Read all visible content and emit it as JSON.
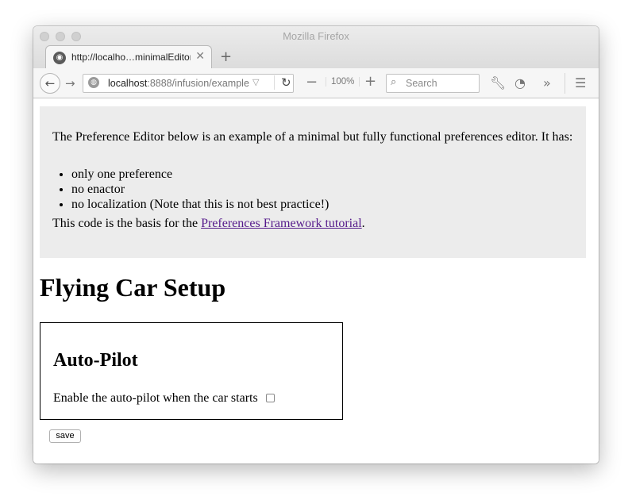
{
  "window": {
    "title": "Mozilla Firefox"
  },
  "tab": {
    "title": "http://localho…minimalEditor/",
    "close": "✕",
    "new_tab": "+"
  },
  "toolbar": {
    "url_host": "localhost",
    "url_rest": ":8888/infusion/example",
    "zoom": "100%",
    "search_placeholder": "Search"
  },
  "intro": {
    "lead": "The Preference Editor below is an example of a minimal but fully functional preferences editor. It has:",
    "items": [
      "only one preference",
      "no enactor",
      "no localization (Note that this is not best practice!)"
    ],
    "basis_prefix": "This code is the basis for the ",
    "basis_link": "Preferences Framework tutorial",
    "basis_suffix": "."
  },
  "page": {
    "title": "Flying Car Setup"
  },
  "panel": {
    "title": "Auto-Pilot",
    "pref_label": "Enable the auto-pilot when the car starts",
    "pref_checked": false
  },
  "actions": {
    "save_label": "save"
  }
}
